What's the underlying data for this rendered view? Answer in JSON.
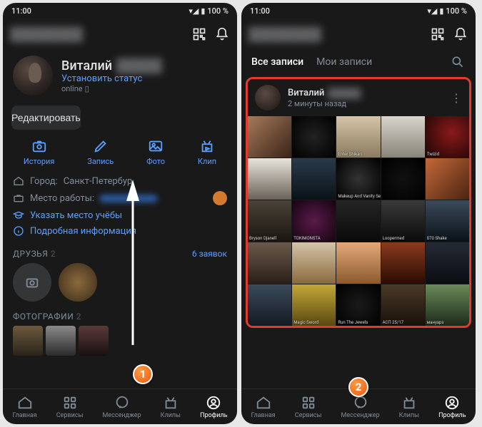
{
  "status": {
    "time": "11:00",
    "battery": "100 %"
  },
  "profile": {
    "name_first": "Виталий",
    "name_last_blurred": "█████",
    "set_status": "Установить статус",
    "online": "online",
    "edit_button": "Редактировать"
  },
  "actions": {
    "story": "История",
    "post": "Запись",
    "photo": "Фото",
    "clip": "Клип"
  },
  "info": {
    "city_label": "Город:",
    "city_value": "Санкт-Петербур",
    "work_label": "Место работы:",
    "education": "Указать место учёбы",
    "details": "Подробная информация"
  },
  "friends": {
    "title": "ДРУЗЬЯ",
    "count": "2",
    "requests": "6 заявок"
  },
  "photos": {
    "title": "ФОТОГРАФИИ",
    "count": "2"
  },
  "nav": {
    "home": "Главная",
    "services": "Сервисы",
    "messenger": "Мессенджер",
    "clips": "Клипы",
    "profile": "Профиль"
  },
  "feed": {
    "tab_all": "Все записи",
    "tab_mine": "Мои записи"
  },
  "post": {
    "author_first": "Виталий",
    "author_last_blurred": "█████",
    "time": "2 минуты назад",
    "captions": [
      "",
      "",
      "Enter Shikari",
      "",
      "Twizid",
      "",
      "",
      "Makeup And Vanity Set",
      "",
      "",
      "Bryson Djanell",
      "TOKIMONSTA",
      "",
      "Loopermed",
      "070 Shake",
      "",
      "",
      "",
      "",
      "",
      "",
      "Magic Sword",
      "Run The Jewels",
      "АСП 25/17",
      "мануарз"
    ]
  },
  "markers": {
    "one": "1",
    "two": "2"
  }
}
